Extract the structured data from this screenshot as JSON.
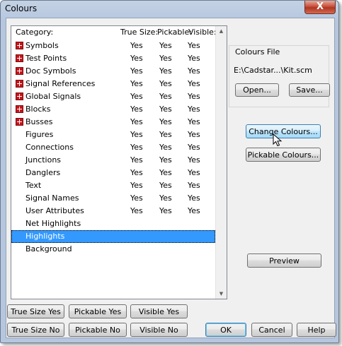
{
  "window": {
    "title": "Colours",
    "close_glyph": "X"
  },
  "list": {
    "headers": {
      "category": "Category:",
      "true_size": "True Size:",
      "pickable": "Pickable:",
      "visible": "Visible:"
    },
    "rows": [
      {
        "name": "Symbols",
        "expandable": true,
        "true_size": "Yes",
        "pickable": "Yes",
        "visible": "Yes"
      },
      {
        "name": "Test Points",
        "expandable": true,
        "true_size": "Yes",
        "pickable": "Yes",
        "visible": "Yes"
      },
      {
        "name": "Doc Symbols",
        "expandable": true,
        "true_size": "Yes",
        "pickable": "Yes",
        "visible": "Yes"
      },
      {
        "name": "Signal References",
        "expandable": true,
        "true_size": "Yes",
        "pickable": "Yes",
        "visible": "Yes"
      },
      {
        "name": "Global Signals",
        "expandable": true,
        "true_size": "Yes",
        "pickable": "Yes",
        "visible": "Yes"
      },
      {
        "name": "Blocks",
        "expandable": true,
        "true_size": "Yes",
        "pickable": "Yes",
        "visible": "Yes"
      },
      {
        "name": "Busses",
        "expandable": true,
        "true_size": "Yes",
        "pickable": "Yes",
        "visible": "Yes"
      },
      {
        "name": "Figures",
        "expandable": false,
        "true_size": "Yes",
        "pickable": "Yes",
        "visible": "Yes"
      },
      {
        "name": "Connections",
        "expandable": false,
        "true_size": "Yes",
        "pickable": "Yes",
        "visible": "Yes"
      },
      {
        "name": "Junctions",
        "expandable": false,
        "true_size": "Yes",
        "pickable": "Yes",
        "visible": "Yes"
      },
      {
        "name": "Danglers",
        "expandable": false,
        "true_size": "Yes",
        "pickable": "Yes",
        "visible": "Yes"
      },
      {
        "name": "Text",
        "expandable": false,
        "true_size": "Yes",
        "pickable": "Yes",
        "visible": "Yes"
      },
      {
        "name": "Signal Names",
        "expandable": false,
        "true_size": "Yes",
        "pickable": "Yes",
        "visible": "Yes"
      },
      {
        "name": "User Attributes",
        "expandable": false,
        "true_size": "Yes",
        "pickable": "Yes",
        "visible": "Yes"
      },
      {
        "name": "Net Highlights",
        "expandable": false,
        "true_size": "",
        "pickable": "",
        "visible": ""
      },
      {
        "name": "Highlights",
        "expandable": false,
        "selected": true,
        "true_size": "",
        "pickable": "",
        "visible": ""
      },
      {
        "name": "Background",
        "expandable": false,
        "true_size": "",
        "pickable": "",
        "visible": ""
      }
    ]
  },
  "colours_file": {
    "label": "Colours File",
    "path": "E:\\Cadstar...\\Kit.scm",
    "open_label": "Open...",
    "save_label": "Save..."
  },
  "actions": {
    "change_colours": "Change Colours...",
    "pickable_colours": "Pickable Colours...",
    "preview": "Preview"
  },
  "bottom": {
    "true_size_yes": "True Size Yes",
    "pickable_yes": "Pickable Yes",
    "visible_yes": "Visible Yes",
    "true_size_no": "True Size No",
    "pickable_no": "Pickable No",
    "visible_no": "Visible No",
    "ok": "OK",
    "cancel": "Cancel",
    "help": "Help"
  },
  "colors": {
    "selection": "#3399ff",
    "expand_box": "#c8141b",
    "close_button": "#c7503c"
  },
  "icons": {
    "expand": "plus-box-icon",
    "close": "close-icon",
    "cursor": "mouse-pointer-icon"
  }
}
